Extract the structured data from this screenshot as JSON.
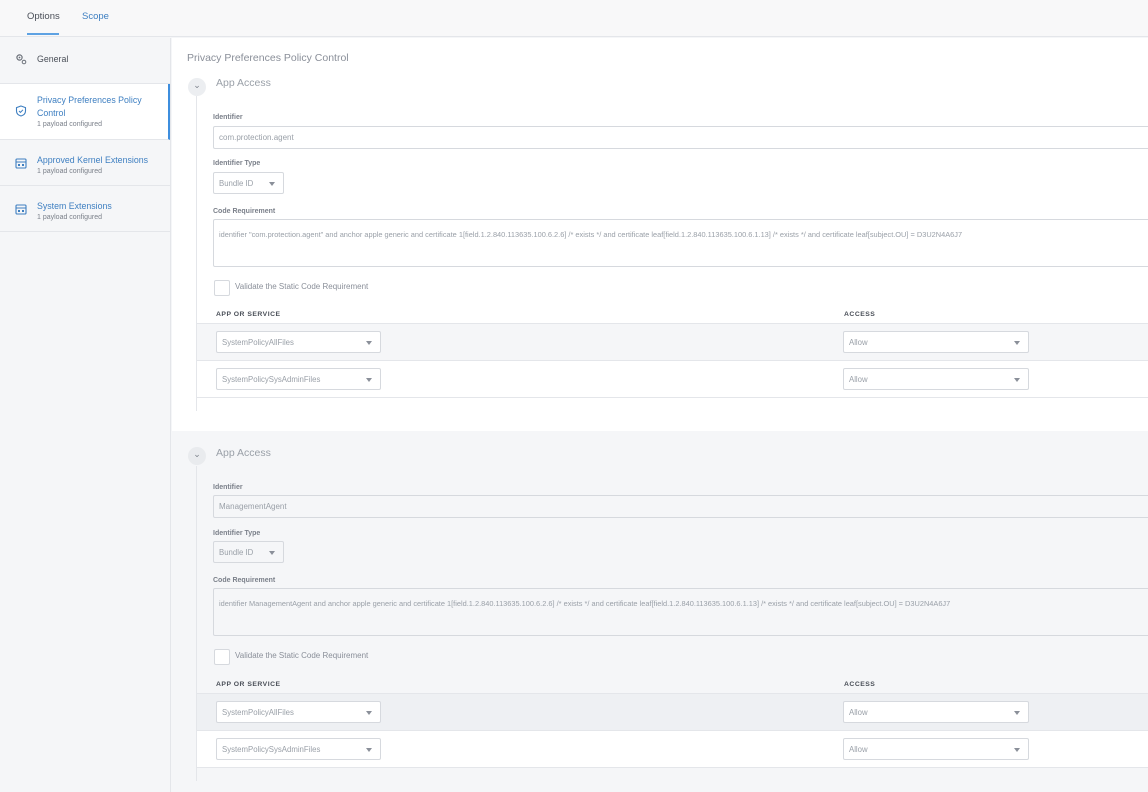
{
  "tabs": [
    {
      "label": "Options"
    },
    {
      "label": "Scope"
    }
  ],
  "sidebar": {
    "items": [
      {
        "label": "General",
        "sub": ""
      },
      {
        "label": "Privacy Preferences Policy Control",
        "line1": "Privacy Preferences Policy",
        "line2": "Control",
        "sub": "1 payload configured"
      },
      {
        "label": "Approved Kernel Extensions",
        "sub": "1 payload configured"
      },
      {
        "label": "System Extensions",
        "sub": "1 payload configured"
      }
    ]
  },
  "main": {
    "title": "Privacy Preferences Policy Control",
    "sections": [
      {
        "title": "App Access",
        "identifier_label": "Identifier",
        "identifier_value": "com.protection.agent",
        "identifier_type_label": "Identifier Type",
        "identifier_type_value": "Bundle ID",
        "code_req_label": "Code Requirement",
        "code_req_value": "identifier \"com.protection.agent\" and anchor apple generic and certificate 1[field.1.2.840.113635.100.6.2.6] /* exists */ and certificate leaf[field.1.2.840.113635.100.6.1.13] /* exists */ and certificate leaf[subject.OU] = D3U2N4A6J7",
        "validate_label": "Validate the Static Code Requirement",
        "col_app": "APP OR SERVICE",
        "col_access": "ACCESS",
        "rows": [
          {
            "service": "SystemPolicyAllFiles",
            "access": "Allow"
          },
          {
            "service": "SystemPolicySysAdminFiles",
            "access": "Allow"
          }
        ]
      },
      {
        "title": "App Access",
        "identifier_label": "Identifier",
        "identifier_value": "ManagementAgent",
        "identifier_type_label": "Identifier Type",
        "identifier_type_value": "Bundle ID",
        "code_req_label": "Code Requirement",
        "code_req_value": "identifier ManagementAgent and anchor apple generic and certificate 1[field.1.2.840.113635.100.6.2.6] /* exists */ and certificate leaf[field.1.2.840.113635.100.6.1.13] /* exists */ and certificate leaf[subject.OU] = D3U2N4A6J7",
        "validate_label": "Validate the Static Code Requirement",
        "col_app": "APP OR SERVICE",
        "col_access": "ACCESS",
        "rows": [
          {
            "service": "SystemPolicyAllFiles",
            "access": "Allow"
          },
          {
            "service": "SystemPolicySysAdminFiles",
            "access": "Allow"
          }
        ]
      }
    ]
  },
  "colors": {
    "accent": "#3e8ede",
    "link": "#3e7fc1",
    "border": "#d6d9de"
  },
  "icons": {
    "general": "gears-icon",
    "privacy": "shield-icon",
    "kernel": "extension-icon",
    "system": "extension-icon"
  }
}
